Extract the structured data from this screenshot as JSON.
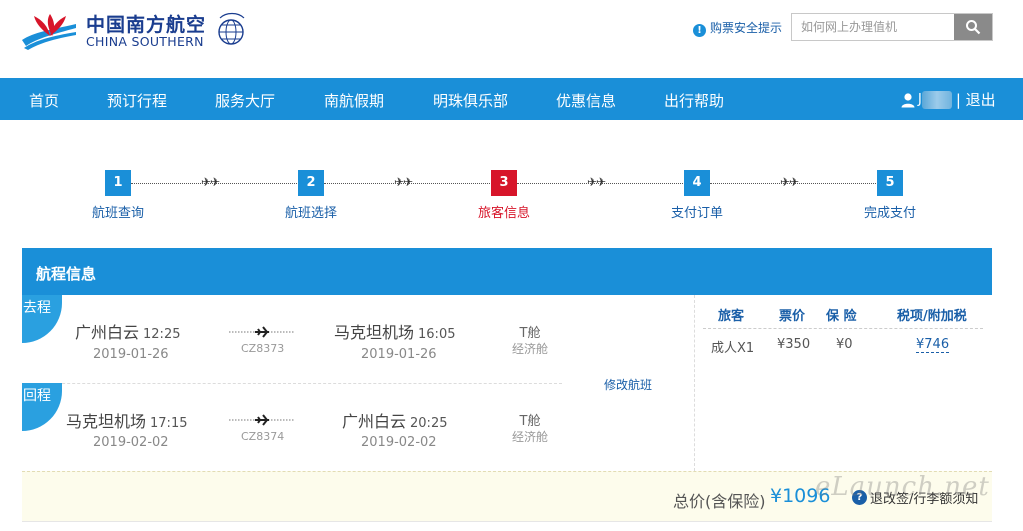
{
  "header": {
    "logo_cn": "中国南方航空",
    "logo_en": "CHINA SOUTHERN",
    "safety_tip": "购票安全提示",
    "search": {
      "placeholder": "如何网上办理值机",
      "value": ""
    }
  },
  "nav": {
    "items": [
      "首页",
      "预订行程",
      "服务大厅",
      "南航假期",
      "明珠俱乐部",
      "优惠信息",
      "出行帮助"
    ],
    "user_initial": "J",
    "logout": "| 退出"
  },
  "steps": [
    {
      "num": "1",
      "label": "航班查询",
      "active": false
    },
    {
      "num": "2",
      "label": "航班选择",
      "active": false
    },
    {
      "num": "3",
      "label": "旅客信息",
      "active": true
    },
    {
      "num": "4",
      "label": "支付订单",
      "active": false
    },
    {
      "num": "5",
      "label": "完成支付",
      "active": false
    }
  ],
  "itinerary": {
    "title": "航程信息",
    "outbound": {
      "tag": "去程",
      "from_city": "广州白云",
      "from_time": "12:25",
      "from_date": "2019-01-26",
      "flight_no": "CZ8373",
      "to_city": "马克坦机场",
      "to_time": "16:05",
      "to_date": "2019-01-26",
      "cabin": "T舱",
      "cabin_type": "经济舱"
    },
    "return": {
      "tag": "回程",
      "from_city": "马克坦机场",
      "from_time": "17:15",
      "from_date": "2019-02-02",
      "flight_no": "CZ8374",
      "to_city": "广州白云",
      "to_time": "20:25",
      "to_date": "2019-02-02",
      "cabin": "T舱",
      "cabin_type": "经济舱"
    },
    "modify_link": "修改航班"
  },
  "fare": {
    "headers": {
      "passenger": "旅客",
      "ticket": "票价",
      "insurance": "保 险",
      "tax": "税项/附加税"
    },
    "row": {
      "passenger": "成人X1",
      "ticket": "¥350",
      "insurance": "¥0",
      "tax": "¥746"
    }
  },
  "total": {
    "label": "总价(含保险)",
    "price": "¥1096",
    "notice": "退改签/行李额须知",
    "watermark": "eLaunch.net"
  },
  "colors": {
    "brand_blue": "#1a8fd8",
    "active_red": "#d7152a",
    "link_blue": "#1a5fa8"
  }
}
